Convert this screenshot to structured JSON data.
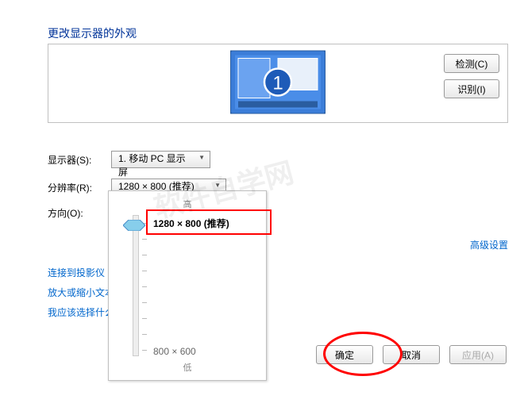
{
  "title": "更改显示器的外观",
  "buttons": {
    "detect": "检测(C)",
    "identify": "识别(I)",
    "ok": "确定",
    "cancel": "取消",
    "apply": "应用(A)"
  },
  "labels": {
    "display": "显示器(S):",
    "resolution": "分辨率(R):",
    "orientation": "方向(O):"
  },
  "dropdowns": {
    "display_value": "1. 移动 PC 显示屏",
    "resolution_value": "1280 × 800 (推荐)"
  },
  "links": {
    "advanced": "高级设置",
    "projector": "连接到投影仪 (",
    "text_size": "放大或缩小文本",
    "which_setting": "我应该选择什么"
  },
  "slider": {
    "high": "高",
    "low": "低",
    "selected": "1280 × 800 (推荐)",
    "min": "800 × 600"
  },
  "monitor_number": "1"
}
